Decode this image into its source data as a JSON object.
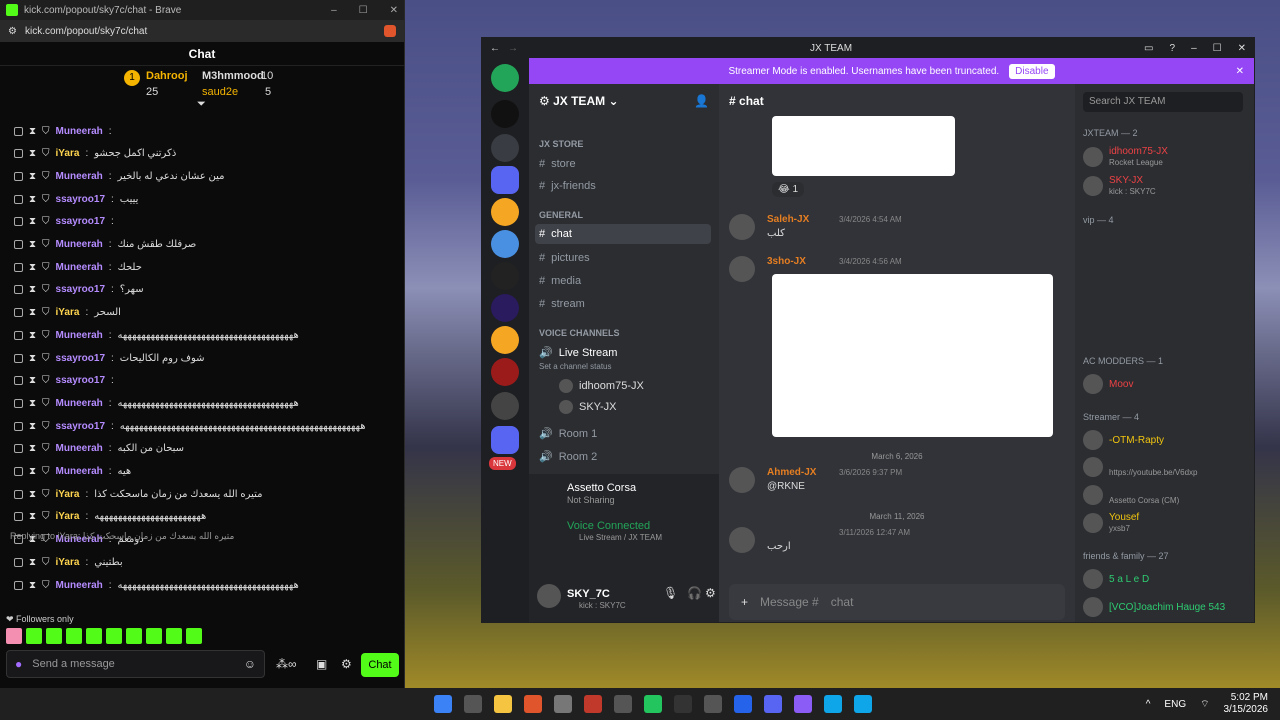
{
  "kick": {
    "window_title": "kick.com/popout/sky7c/chat - Brave",
    "url": "kick.com/popout/sky7c/chat",
    "header": "Chat",
    "leaders": [
      {
        "name": "Dahrooj",
        "count": "25"
      },
      {
        "name": "M3hmmood",
        "count": "10"
      },
      {
        "name": "saud2e",
        "count": "5"
      }
    ],
    "messages": [
      {
        "user": "Muneerah",
        "text": "",
        "color": "purple"
      },
      {
        "user": "iYara",
        "text": "ذكرتني اكمل جحشو",
        "color": "yellow"
      },
      {
        "user": "Muneerah",
        "text": "مين عشان ندعي له بالخير",
        "color": "purple"
      },
      {
        "user": "ssayroo17",
        "text": "يييب",
        "color": "purple"
      },
      {
        "user": "ssayroo17",
        "text": "",
        "color": "purple"
      },
      {
        "user": "Muneerah",
        "text": "صرفلك طقش منك",
        "color": "purple"
      },
      {
        "user": "Muneerah",
        "text": "حلحك",
        "color": "purple"
      },
      {
        "user": "ssayroo17",
        "text": "سهر؟",
        "color": "purple"
      },
      {
        "user": "iYara",
        "text": "السحر",
        "color": "yellow"
      },
      {
        "user": "Muneerah",
        "text": "ههههههههههههههههههههههههههههههههههههههه",
        "color": "purple"
      },
      {
        "user": "ssayroo17",
        "text": "شوف روم الكاليحات",
        "color": "purple"
      },
      {
        "user": "ssayroo17",
        "text": "",
        "color": "purple"
      },
      {
        "user": "Muneerah",
        "text": "ههههههههههههههههههههههههههههههههههههههه",
        "color": "purple"
      },
      {
        "user": "ssayroo17",
        "text": "ههههههههههههههههههههههههههههههههههههههههههههههههههههه",
        "color": "purple"
      },
      {
        "user": "Muneerah",
        "text": "سبحان من الكبه",
        "color": "purple"
      },
      {
        "user": "Muneerah",
        "text": "هيه",
        "color": "purple"
      },
      {
        "user": "iYara",
        "text": "متيره الله يسعدك من زمان ماسحكت كذا",
        "color": "yellow"
      },
      {
        "user": "iYara",
        "text": "هههههههههههههههههههههههه",
        "color": "yellow"
      },
      {
        "user": "Muneerah",
        "text": "دومعم",
        "color": "purple"
      },
      {
        "user": "iYara",
        "text": "بطتيني",
        "color": "yellow"
      },
      {
        "user": "Muneerah",
        "text": "ههههههههههههههههههههههههههههههههههههههه",
        "color": "purple"
      }
    ],
    "reply": "Replying to iYara: متيره الله يسعدك من زمان ماسحكت كذا",
    "followers": "Followers only",
    "input_placeholder": "Send a message",
    "send": "Chat"
  },
  "discord": {
    "title": "JX TEAM",
    "banner": "Streamer Mode is enabled. Usernames have been truncated.",
    "disable": "Disable",
    "server": "JX TEAM",
    "channel": "chat",
    "search": "Search JX TEAM",
    "categories": {
      "store": "JX STORE",
      "general": "GENERAL",
      "voice": "VOICE CHANNELS"
    },
    "channels": [
      "store",
      "jx-friends",
      "chat",
      "pictures",
      "media",
      "stream"
    ],
    "voice": {
      "live": "Live Stream",
      "status": "Set a channel status",
      "users": [
        "idhoom75-JX",
        "SKY-JX"
      ],
      "rooms": [
        "Room 1",
        "Room 2"
      ]
    },
    "activity": {
      "name": "Assetto Corsa",
      "state": "Not Sharing"
    },
    "vc": {
      "title": "Voice Connected",
      "sub": "Live Stream / JX TEAM"
    },
    "user": {
      "name": "SKY_7C",
      "sub": "kick : SKY7C"
    },
    "messages": [
      {
        "user": "Saleh-JX",
        "time": "3/4/2026 4:54 AM",
        "text": "كلب"
      },
      {
        "user": "3sho-JX",
        "time": "3/4/2026 4:56 AM",
        "text": ""
      },
      {
        "user": "Ahmed-JX",
        "time": "3/6/2026 9:37 PM",
        "text": "@RKNE"
      },
      {
        "user": "",
        "time": "3/11/2026 12:47 AM",
        "text": "ارحب"
      }
    ],
    "dividers": [
      "March 6, 2026",
      "March 11, 2026"
    ],
    "reaction": "1",
    "message_placeholder": "Message #",
    "members": {
      "groups": [
        "JXTEAM — 2",
        "vip — 4",
        "AC MODDERS — 1",
        "Streamer — 4",
        "friends & family — 27"
      ],
      "jx": [
        {
          "name": "idhoom75-JX",
          "sub": "Rocket League"
        },
        {
          "name": "SKY-JX",
          "sub": "kick : SKY7C"
        }
      ],
      "ac": "Moov",
      "streamers": [
        {
          "name": "-OTM-Rapty",
          "sub": ""
        },
        {
          "name": "",
          "sub": "https://youtube.be/V6dxp"
        },
        {
          "name": "",
          "sub": "Assetto Corsa (CM)"
        },
        {
          "name": "Yousef",
          "sub": "yxsb7"
        }
      ],
      "friends": [
        {
          "name": "5 a L e D",
          "sub": ""
        },
        {
          "name": "[VCO]Joachim Hauge 543",
          "sub": ""
        }
      ]
    }
  },
  "taskbar": {
    "lang": "ENG",
    "time": "5:02 PM",
    "date": "3/15/2026"
  }
}
